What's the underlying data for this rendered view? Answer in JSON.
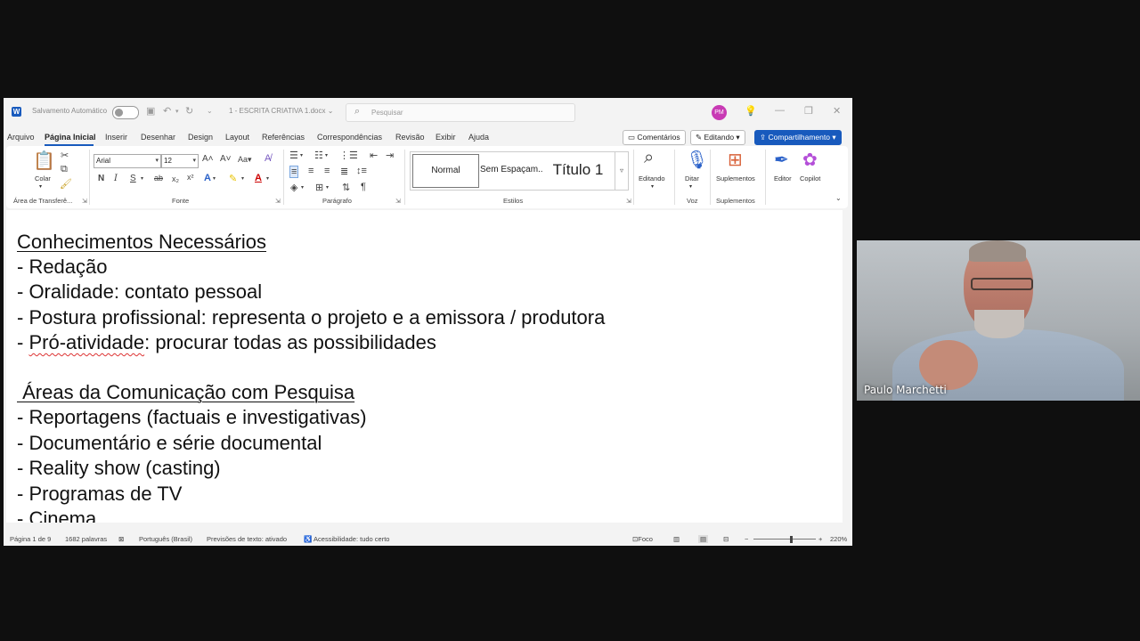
{
  "titlebar": {
    "autosave_label": "Salvamento Automático",
    "document_name": "1 - ESCRITA CRIATIVA 1.docx",
    "search_placeholder": "Pesquisar",
    "user_initials": "PM"
  },
  "menu": {
    "items": [
      "Arquivo",
      "Página Inicial",
      "Inserir",
      "Desenhar",
      "Design",
      "Layout",
      "Referências",
      "Correspondências",
      "Revisão",
      "Exibir",
      "Ajuda"
    ],
    "active": "Página Inicial",
    "comments_label": "Comentários",
    "editing_label": "Editando",
    "share_label": "Compartilhamento"
  },
  "ribbon": {
    "clipboard": {
      "paste_label": "Colar",
      "group_label": "Área de Transferê..."
    },
    "font": {
      "family": "Arial",
      "size": "12",
      "group_label": "Fonte"
    },
    "paragraph": {
      "group_label": "Parágrafo"
    },
    "styles": {
      "normal": "Normal",
      "no_spacing": "Sem Espaçam...",
      "title1": "Título 1",
      "group_label": "Estilos"
    },
    "editing": {
      "label": "Editando"
    },
    "voice": {
      "dictate_label": "Ditar",
      "group_label": "Voz"
    },
    "addins": {
      "label": "Suplementos",
      "group_label": "Suplementos"
    },
    "editor_label": "Editor",
    "copilot_label": "Copilot"
  },
  "document": {
    "heading1": "Conhecimentos Necessários",
    "list1": [
      "- Redação",
      "- Oralidade: contato pessoal",
      "- Postura profissional: representa o projeto e a emissora / produtora"
    ],
    "list1_last_prefix": "- ",
    "list1_last_flagged": "Pró-atividade",
    "list1_last_rest": ": procurar todas as possibilidades",
    "heading2": " Áreas da Comunicação com Pesquisa",
    "list2": [
      "- Reportagens (factuais e investigativas)",
      "- Documentário e série documental",
      "- Reality show (casting)",
      "- Programas de TV",
      "- Cinema"
    ]
  },
  "statusbar": {
    "page": "Página 1 de 9",
    "words": "1682 palavras",
    "language": "Português (Brasil)",
    "predictions": "Previsões de texto: ativado",
    "accessibility": "Acessibilidade: tudo certo",
    "focus": "Foco",
    "zoom": "220%"
  },
  "webcam": {
    "participant_name": "Paulo Marchetti"
  },
  "colors": {
    "word_blue": "#185abd",
    "avatar": "#c83ab4",
    "spell_error": "#dd3333"
  }
}
